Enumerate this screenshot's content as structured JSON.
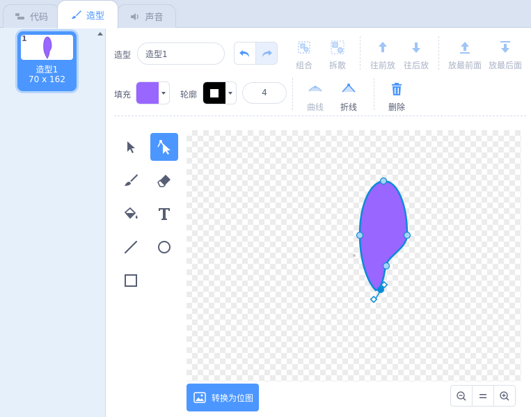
{
  "tabs": [
    {
      "label": "代码",
      "icon": "code-icon"
    },
    {
      "label": "造型",
      "icon": "brush-icon"
    },
    {
      "label": "声音",
      "icon": "speaker-icon"
    }
  ],
  "costumes": [
    {
      "number": "1",
      "name": "造型1",
      "size": "70 x 162"
    }
  ],
  "toolbar": {
    "costume_label": "造型",
    "costume_name": "造型1",
    "group": "组合",
    "ungroup": "拆散",
    "forward": "往前放",
    "backward": "往后放",
    "front": "放最前面",
    "back": "放最后面",
    "fill_label": "填充",
    "fill_color": "#9966ff",
    "outline_label": "轮廓",
    "outline_color": "#000000",
    "outline_width": "4",
    "curved": "曲线",
    "pointed": "折线",
    "delete": "删除"
  },
  "tools": [
    "select-tool",
    "reshape-tool",
    "brush-tool",
    "eraser-tool",
    "fill-tool",
    "text-tool",
    "line-tool",
    "circle-tool",
    "rectangle-tool"
  ],
  "convert_button": "转换为位图",
  "colors": {
    "accent": "#4c97ff",
    "shape_fill": "#9966ff",
    "shape_stroke": "#0b8bd6"
  }
}
